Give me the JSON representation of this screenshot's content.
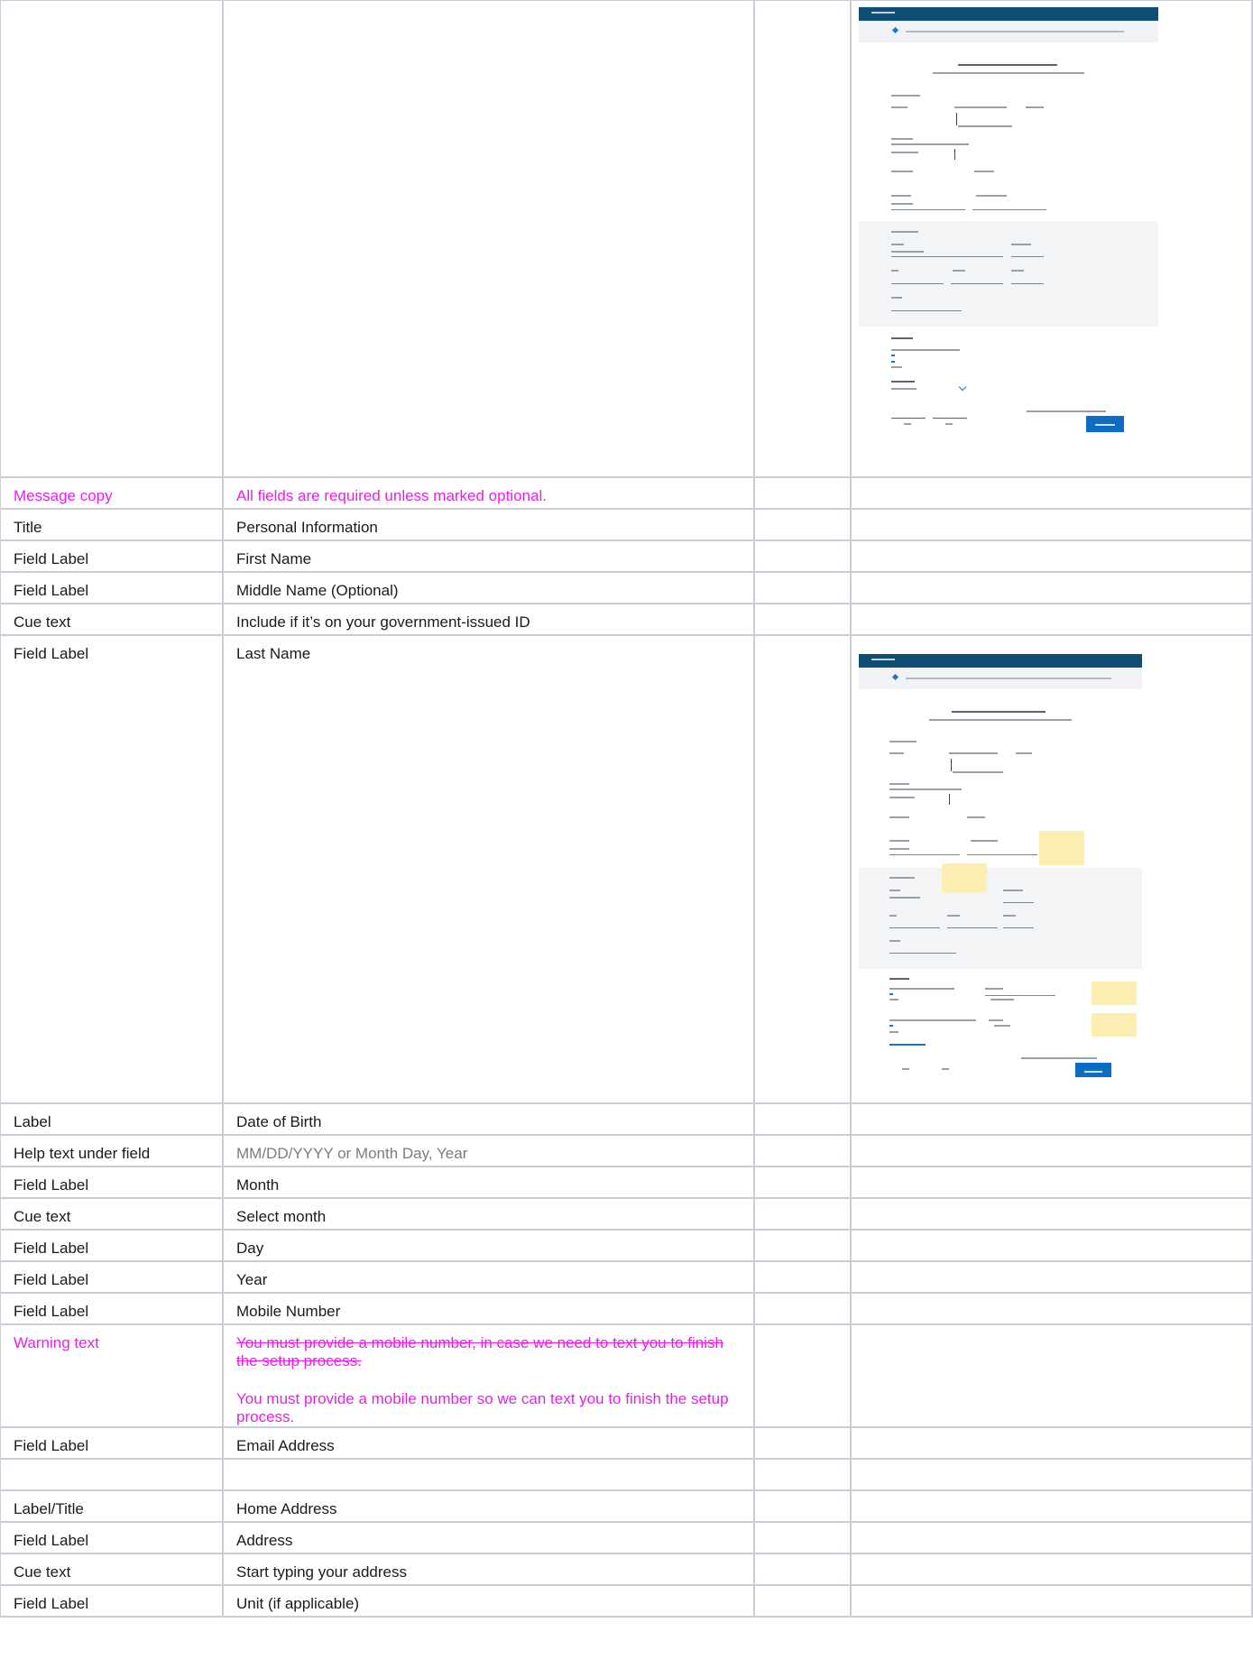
{
  "rows": [
    {
      "key": "",
      "value": ""
    },
    {
      "key": "Message copy",
      "value": "All fields are required unless marked optional."
    },
    {
      "key": "Title",
      "value": "Personal Information"
    },
    {
      "key": "Field Label",
      "value": "First Name"
    },
    {
      "key": "Field Label",
      "value": "Middle Name (Optional)"
    },
    {
      "key": "Cue text",
      "value": "Include if it’s on your government-issued ID"
    },
    {
      "key": "Field Label",
      "value": "Last Name"
    },
    {
      "key": "Label",
      "value": "Date of Birth"
    },
    {
      "key": "Help text under field",
      "value": "MM/DD/YYYY or Month Day, Year"
    },
    {
      "key": "Field Label",
      "value": "Month"
    },
    {
      "key": "Cue text",
      "value": "Select month"
    },
    {
      "key": "Field Label",
      "value": "Day"
    },
    {
      "key": "Field Label",
      "value": "Year"
    },
    {
      "key": "Field Label",
      "value": "Mobile Number"
    },
    {
      "key": "Warning text",
      "value": "",
      "old_value": "You must provide a mobile number, in case we need to text you to finish the setup process.",
      "new_value": "You must provide a mobile number so we can text you to finish the setup process."
    },
    {
      "key": "Field Label",
      "value": "Email Address"
    },
    {
      "key": "",
      "value": ""
    },
    {
      "key": "Label/Title",
      "value": "Home Address"
    },
    {
      "key": "Field Label",
      "value": "Address"
    },
    {
      "key": "Cue text",
      "value": "Start typing your address"
    },
    {
      "key": "Field Label",
      "value": "Unit (if applicable)"
    }
  ],
  "colors": {
    "highlight": "#e81ee8",
    "muted": "#7c7c7c",
    "border": "#c8cdd8",
    "mock_header": "#0e4d74",
    "mock_button": "#0d6cc4",
    "sticky_note": "#fdeeb2"
  }
}
